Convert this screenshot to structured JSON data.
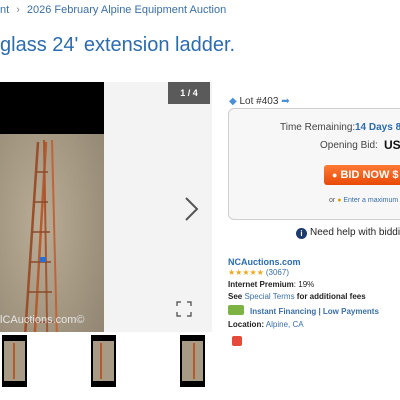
{
  "breadcrumb": {
    "left": "nt",
    "current": "2026 February Alpine Equipment Auction"
  },
  "page_title": "glass 24' extension ladder.",
  "gallery": {
    "counter": "1 / 4",
    "watermark": "lCAuctions.com©"
  },
  "bid_panel": {
    "lot": "Lot #403",
    "time_label": "Time Remaining:",
    "time_value": "14 Days 8",
    "opening_label": "Opening Bid:",
    "opening_value": "US",
    "bid_button": "BID NOW $",
    "max_prefix": "or",
    "max_link": "Enter a maximum",
    "help": "Need help with biddin"
  },
  "seller": {
    "name": "NCAuctions.com",
    "stars": "★★★★★",
    "reviews": "(3067)",
    "premium_label": "Internet Premium",
    "premium_value": ": 19%",
    "terms_prefix": "See",
    "terms_link": "Special Terms",
    "terms_suffix": "for additional fees",
    "finance_link": "Instant Financing | Low Payments",
    "location_label": "Location:",
    "location_value": "Alpine, CA"
  },
  "colors": {
    "link": "#2b6cb0",
    "bid_button": "#e84a08",
    "stars": "#f0a818"
  }
}
